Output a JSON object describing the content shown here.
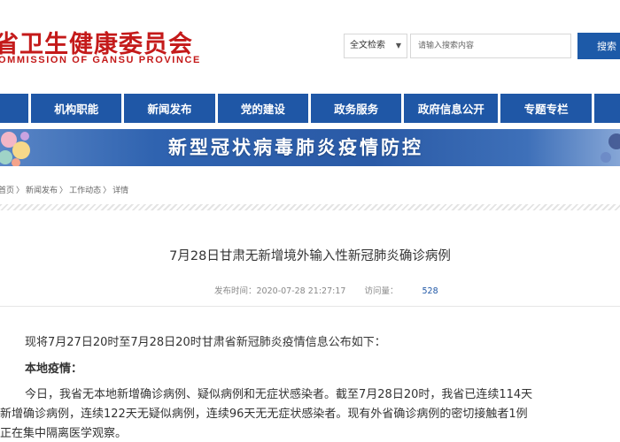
{
  "header": {
    "logo_cn": "省卫生健康委员会",
    "logo_en": "OMMISSION  OF  GANSU PROVINCE",
    "search_scope": "全文检索",
    "search_placeholder": "请输入搜索内容",
    "search_button": "搜索"
  },
  "nav": {
    "items": [
      {
        "label": ""
      },
      {
        "label": "机构职能"
      },
      {
        "label": "新闻发布"
      },
      {
        "label": "党的建设"
      },
      {
        "label": "政务服务"
      },
      {
        "label": "政府信息公开"
      },
      {
        "label": "专题专栏"
      },
      {
        "label": ""
      }
    ]
  },
  "banner": {
    "text": "新型冠状病毒肺炎疫情防控"
  },
  "breadcrumb": {
    "home": "首页",
    "sep": "〉",
    "level1": "新闻发布",
    "level2": "工作动态",
    "level3": "详情"
  },
  "article": {
    "title": "7月28日甘肃无新增境外输入性新冠肺炎确诊病例",
    "publish_label": "发布时间：",
    "publish_time": "2020-07-28 21:27:17",
    "visits_label": "访问量：",
    "visits_count": "528",
    "intro": "现将7月27日20时至7月28日20时甘肃省新冠肺炎疫情信息公布如下：",
    "heading": "本地疫情：",
    "body_lines": [
      "今日，我省无本地新增确诊病例、疑似病例和无症状感染者。截至7月28日20时，我省已连续114天",
      "新增确诊病例，连续122天无疑似病例，连续96天无无症状感染者。现有外省确诊病例的密切接触者1例",
      "正在集中隔离医学观察。"
    ]
  },
  "colors": {
    "brand_red": "#c41a1a",
    "nav_blue": "#1f57a6",
    "search_blue": "#1d5aa8"
  }
}
